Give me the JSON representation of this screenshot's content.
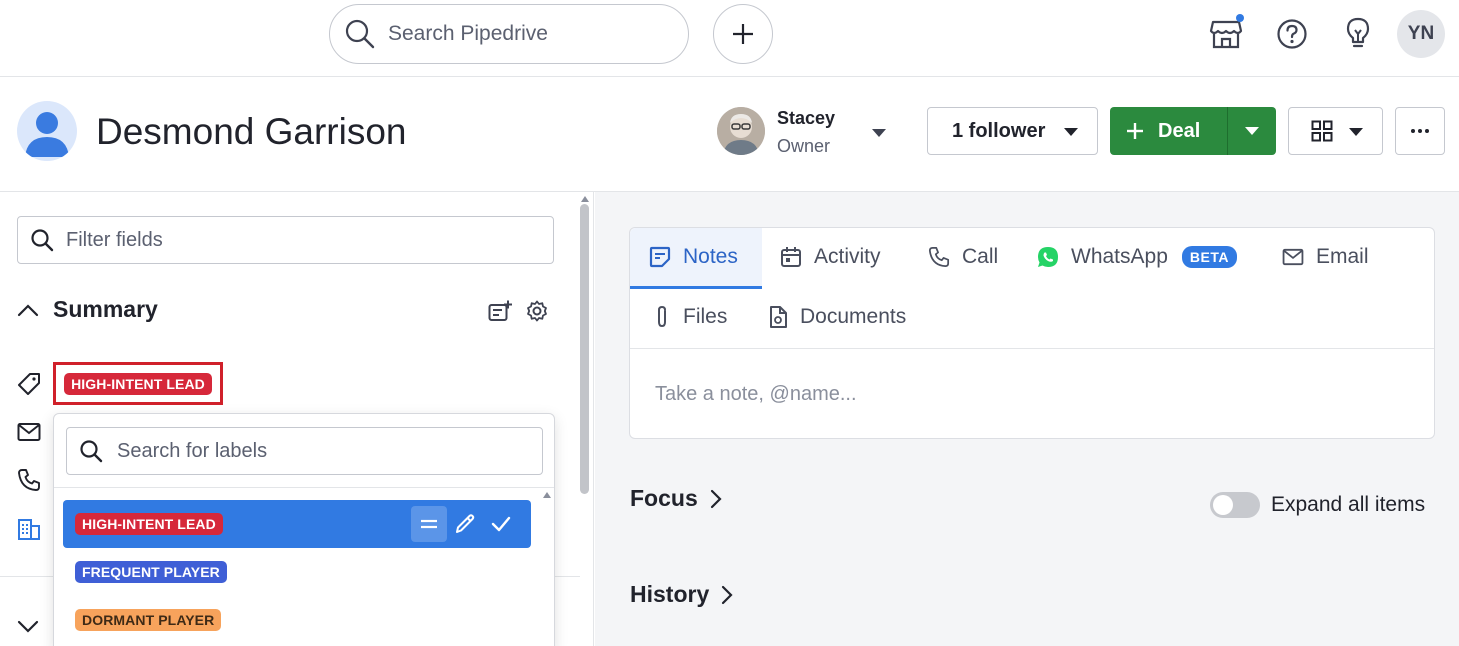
{
  "topbar": {
    "search_placeholder": "Search Pipedrive",
    "user_initials": "YN",
    "icons": [
      "search-icon",
      "plus-icon",
      "marketplace-icon",
      "help-icon",
      "lightbulb-icon"
    ]
  },
  "header": {
    "person_name": "Desmond Garrison",
    "owner_name": "Stacey",
    "owner_role": "Owner",
    "followers_label": "1 follower",
    "deal_label": "Deal"
  },
  "left": {
    "filter_placeholder": "Filter fields",
    "summary_title": "Summary",
    "current_label": "HIGH-INTENT LEAD"
  },
  "dropdown": {
    "search_placeholder": "Search for labels",
    "labels": [
      {
        "text": "HIGH-INTENT LEAD",
        "color": "#d6283a",
        "selected": true
      },
      {
        "text": "FREQUENT PLAYER",
        "color": "#3f5fd6",
        "selected": false
      },
      {
        "text": "DORMANT PLAYER",
        "color": "#f7a35c",
        "selected": false
      }
    ]
  },
  "composer": {
    "tabs": [
      {
        "label": "Notes",
        "icon": "note-icon",
        "active": true
      },
      {
        "label": "Activity",
        "icon": "calendar-icon"
      },
      {
        "label": "Call",
        "icon": "phone-icon"
      },
      {
        "label": "WhatsApp",
        "icon": "whatsapp-icon",
        "badge": "BETA"
      },
      {
        "label": "Email",
        "icon": "email-icon"
      },
      {
        "label": "Files",
        "icon": "paperclip-icon"
      },
      {
        "label": "Documents",
        "icon": "document-icon"
      }
    ],
    "placeholder": "Take a note, @name..."
  },
  "right": {
    "focus_title": "Focus",
    "history_title": "History",
    "expand_label": "Expand all items",
    "expand_enabled": false
  },
  "colors": {
    "accent": "#317ae2",
    "deal_green": "#2b8a3e",
    "highlight_border": "#d0202a"
  }
}
